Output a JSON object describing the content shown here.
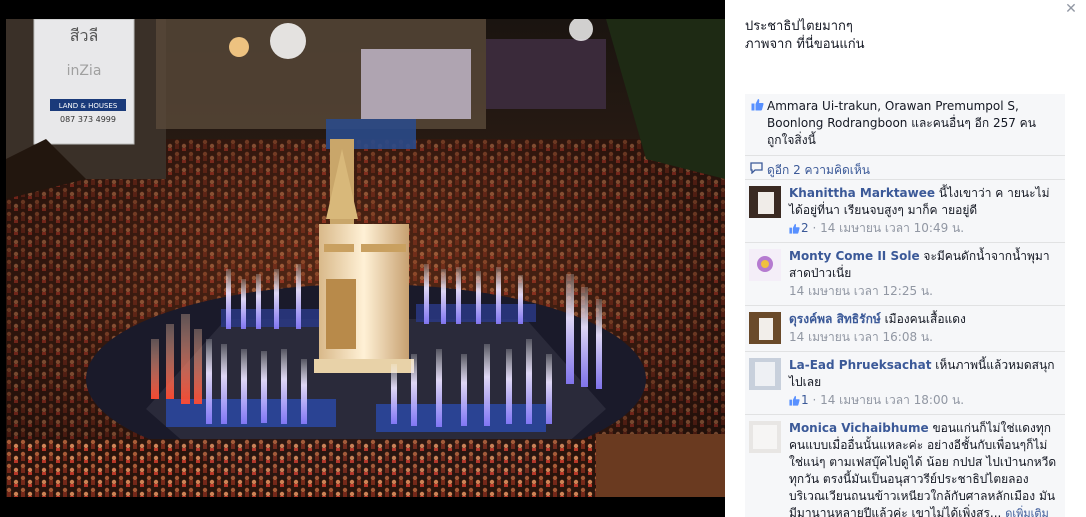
{
  "photo": {
    "sign_name": "สีวลี",
    "sign_brand": "inZia",
    "sign_store": "LAND & HOUSES",
    "sign_phone": "087 373 4999"
  },
  "caption": {
    "line1": "ประชาธิปไตยมากๆ",
    "line2": "ภาพจาก ที่นี่ขอนแก่น"
  },
  "likes": {
    "text": "Ammara Ui-trakun, Orawan Premumpol S, Boonlong Rodrangboon และคนอื่นๆ อีก 257 คนถูกใจสิ่งนี้"
  },
  "more_comments": {
    "label": "ดูอีก 2 ความคิดเห็น"
  },
  "comments": [
    {
      "author": "Khanittha Marktawee",
      "text": "นี้ไงเขาว่า ค ายนะไม่ได้อยู่ที่นา เรียนจบสูงๆ มาก็ค ายอยู่ดี",
      "likes": "2",
      "time": "14 เมษายน เวลา 10:49 น."
    },
    {
      "author": "Monty Come II Sole",
      "text": "จะมีคนดักน้ำจากน้ำพุมาสาดป่าวเนี่ย",
      "likes": "",
      "time": "14 เมษายน เวลา 12:25 น."
    },
    {
      "author": "ดุรงค์พล สิทธิรักษ์",
      "text": "เมืองคนเสื้อแดง",
      "likes": "",
      "time": "14 เมษายน เวลา 16:08 น."
    },
    {
      "author": "La-Ead Phrueksachat",
      "text": "เห็นภาพนี้แล้วหมดสนุกไปเลย",
      "likes": "1",
      "time": "14 เมษายน เวลา 18:00 น."
    },
    {
      "author": "Monica Vichaibhume",
      "text": "ขอนแก่นก็ไม่ใช่แดงทุกคนแบบเมื่ออื่นนั้นแหละค่ะ อย่างอีชั้นกับเพื่อนๆก็ไม่ใช่แน่ๆ ตามเฟสบุ๊คไปดูได้ น้อย กปปส ไปเป่านกหวีดทุกวัน ตรงนี้มันเป็นอนุสาวรีย์ประชาธิปไตยลองบริเวณเวียนถนนข้าวเหนียวใกล้กับศาลหลักเมือง มันมีมานานหลายปีแล้วค่ะ เขาไม่ได้เพิ่งสร...",
      "see_more": "ดูเพิ่มเติม",
      "likes": "",
      "time": ""
    }
  ]
}
